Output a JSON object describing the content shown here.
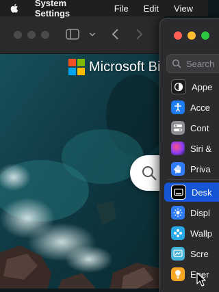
{
  "menubar": {
    "app_name": "System Settings",
    "items": [
      "File",
      "Edit",
      "View"
    ]
  },
  "browser": {
    "logo_text": "Microsoft Bi",
    "icons": [
      "sidebar-toggle-icon",
      "chevron-down-icon",
      "back-arrow-icon",
      "forward-arrow-icon",
      "search-icon"
    ]
  },
  "settings": {
    "search_placeholder": "Search",
    "items": [
      {
        "label": "Appe",
        "icon": "appearance-icon",
        "color": "#1c1c1e"
      },
      {
        "label": "Acce",
        "icon": "accessibility-icon",
        "color": "#1a7cf0"
      },
      {
        "label": "Cont",
        "icon": "control-centre-icon",
        "color": "#8e8e93"
      },
      {
        "label": "Siri &",
        "icon": "siri-icon",
        "color": "#8a3df2"
      },
      {
        "label": "Priva",
        "icon": "privacy-hand-icon",
        "color": "#2f7bf5"
      },
      {
        "label": "Desk",
        "icon": "desktop-dock-icon",
        "color": "#000000"
      },
      {
        "label": "Displ",
        "icon": "displays-icon",
        "color": "#2f7bf5"
      },
      {
        "label": "Wallp",
        "icon": "wallpaper-icon",
        "color": "#29a8e8"
      },
      {
        "label": "Scre",
        "icon": "screen-saver-icon",
        "color": "#46b4d8"
      },
      {
        "label": "Ener",
        "icon": "energy-bulb-icon",
        "color": "#f5a623"
      }
    ]
  },
  "colors": {
    "selection": "#1656d6",
    "close": "#ff5f57",
    "minimize": "#febc2e",
    "zoom": "#28c840"
  }
}
